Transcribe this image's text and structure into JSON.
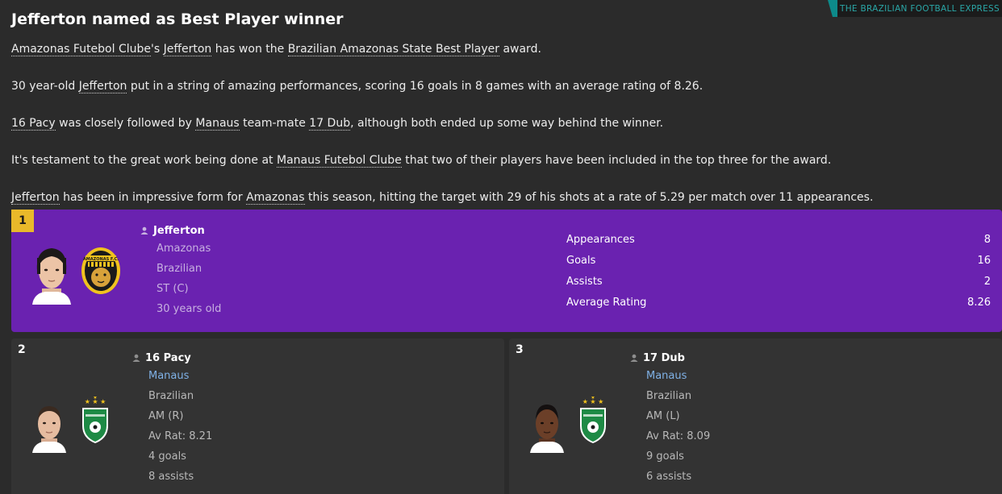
{
  "source": "THE BRAZILIAN FOOTBALL EXPRESS",
  "headline": "Jefferton named as Best Player winner",
  "paragraphs": {
    "p1": {
      "a": "Amazonas Futebol Clube",
      "b": "'s ",
      "c": "Jefferton",
      "d": " has won the ",
      "e": "Brazilian Amazonas State Best Player",
      "f": " award."
    },
    "p2": {
      "a": "30 year-old ",
      "b": "Jefferton",
      "c": " put in a string of amazing performances, scoring 16 goals in 8 games with an average rating of 8.26."
    },
    "p3": {
      "a": "16 Pacy",
      "b": " was closely followed by ",
      "c": "Manaus",
      "d": " team-mate ",
      "e": "17 Dub",
      "f": ", although both ended up some way behind the winner."
    },
    "p4": {
      "a": "It's testament to the great work being done at ",
      "b": "Manaus Futebol Clube",
      "c": " that two of their players have been included in the top three for the award."
    },
    "p5": {
      "a": "Jefferton",
      "b": " has been in impressive form for ",
      "c": "Amazonas",
      "d": " this season, hitting the target with 29 of his shots at a rate of 5.29 per match over 11 appearances."
    }
  },
  "winner": {
    "rank": "1",
    "name": "Jefferton",
    "club": "Amazonas",
    "nationality": "Brazilian",
    "position": "ST (C)",
    "age": "30 years old",
    "crest_text": "AMAZONAS F.C.",
    "stats": [
      {
        "label": "Appearances",
        "value": "8"
      },
      {
        "label": "Goals",
        "value": "16"
      },
      {
        "label": "Assists",
        "value": "2"
      },
      {
        "label": "Average Rating",
        "value": "8.26"
      }
    ]
  },
  "second": {
    "rank": "2",
    "name": "16 Pacy",
    "club": "Manaus",
    "nationality": "Brazilian",
    "position": "AM (R)",
    "rating": "Av Rat: 8.21",
    "goals": "4 goals",
    "assists": "8 assists"
  },
  "third": {
    "rank": "3",
    "name": "17 Dub",
    "club": "Manaus",
    "nationality": "Brazilian",
    "position": "AM (L)",
    "rating": "Av Rat: 8.09",
    "goals": "9 goals",
    "assists": "6 assists"
  },
  "colors": {
    "winner_bg": "#6a22b0",
    "gold_badge": "#e9b92a",
    "link_blue": "#7fb1e6",
    "source_teal": "#2aa7a7"
  }
}
